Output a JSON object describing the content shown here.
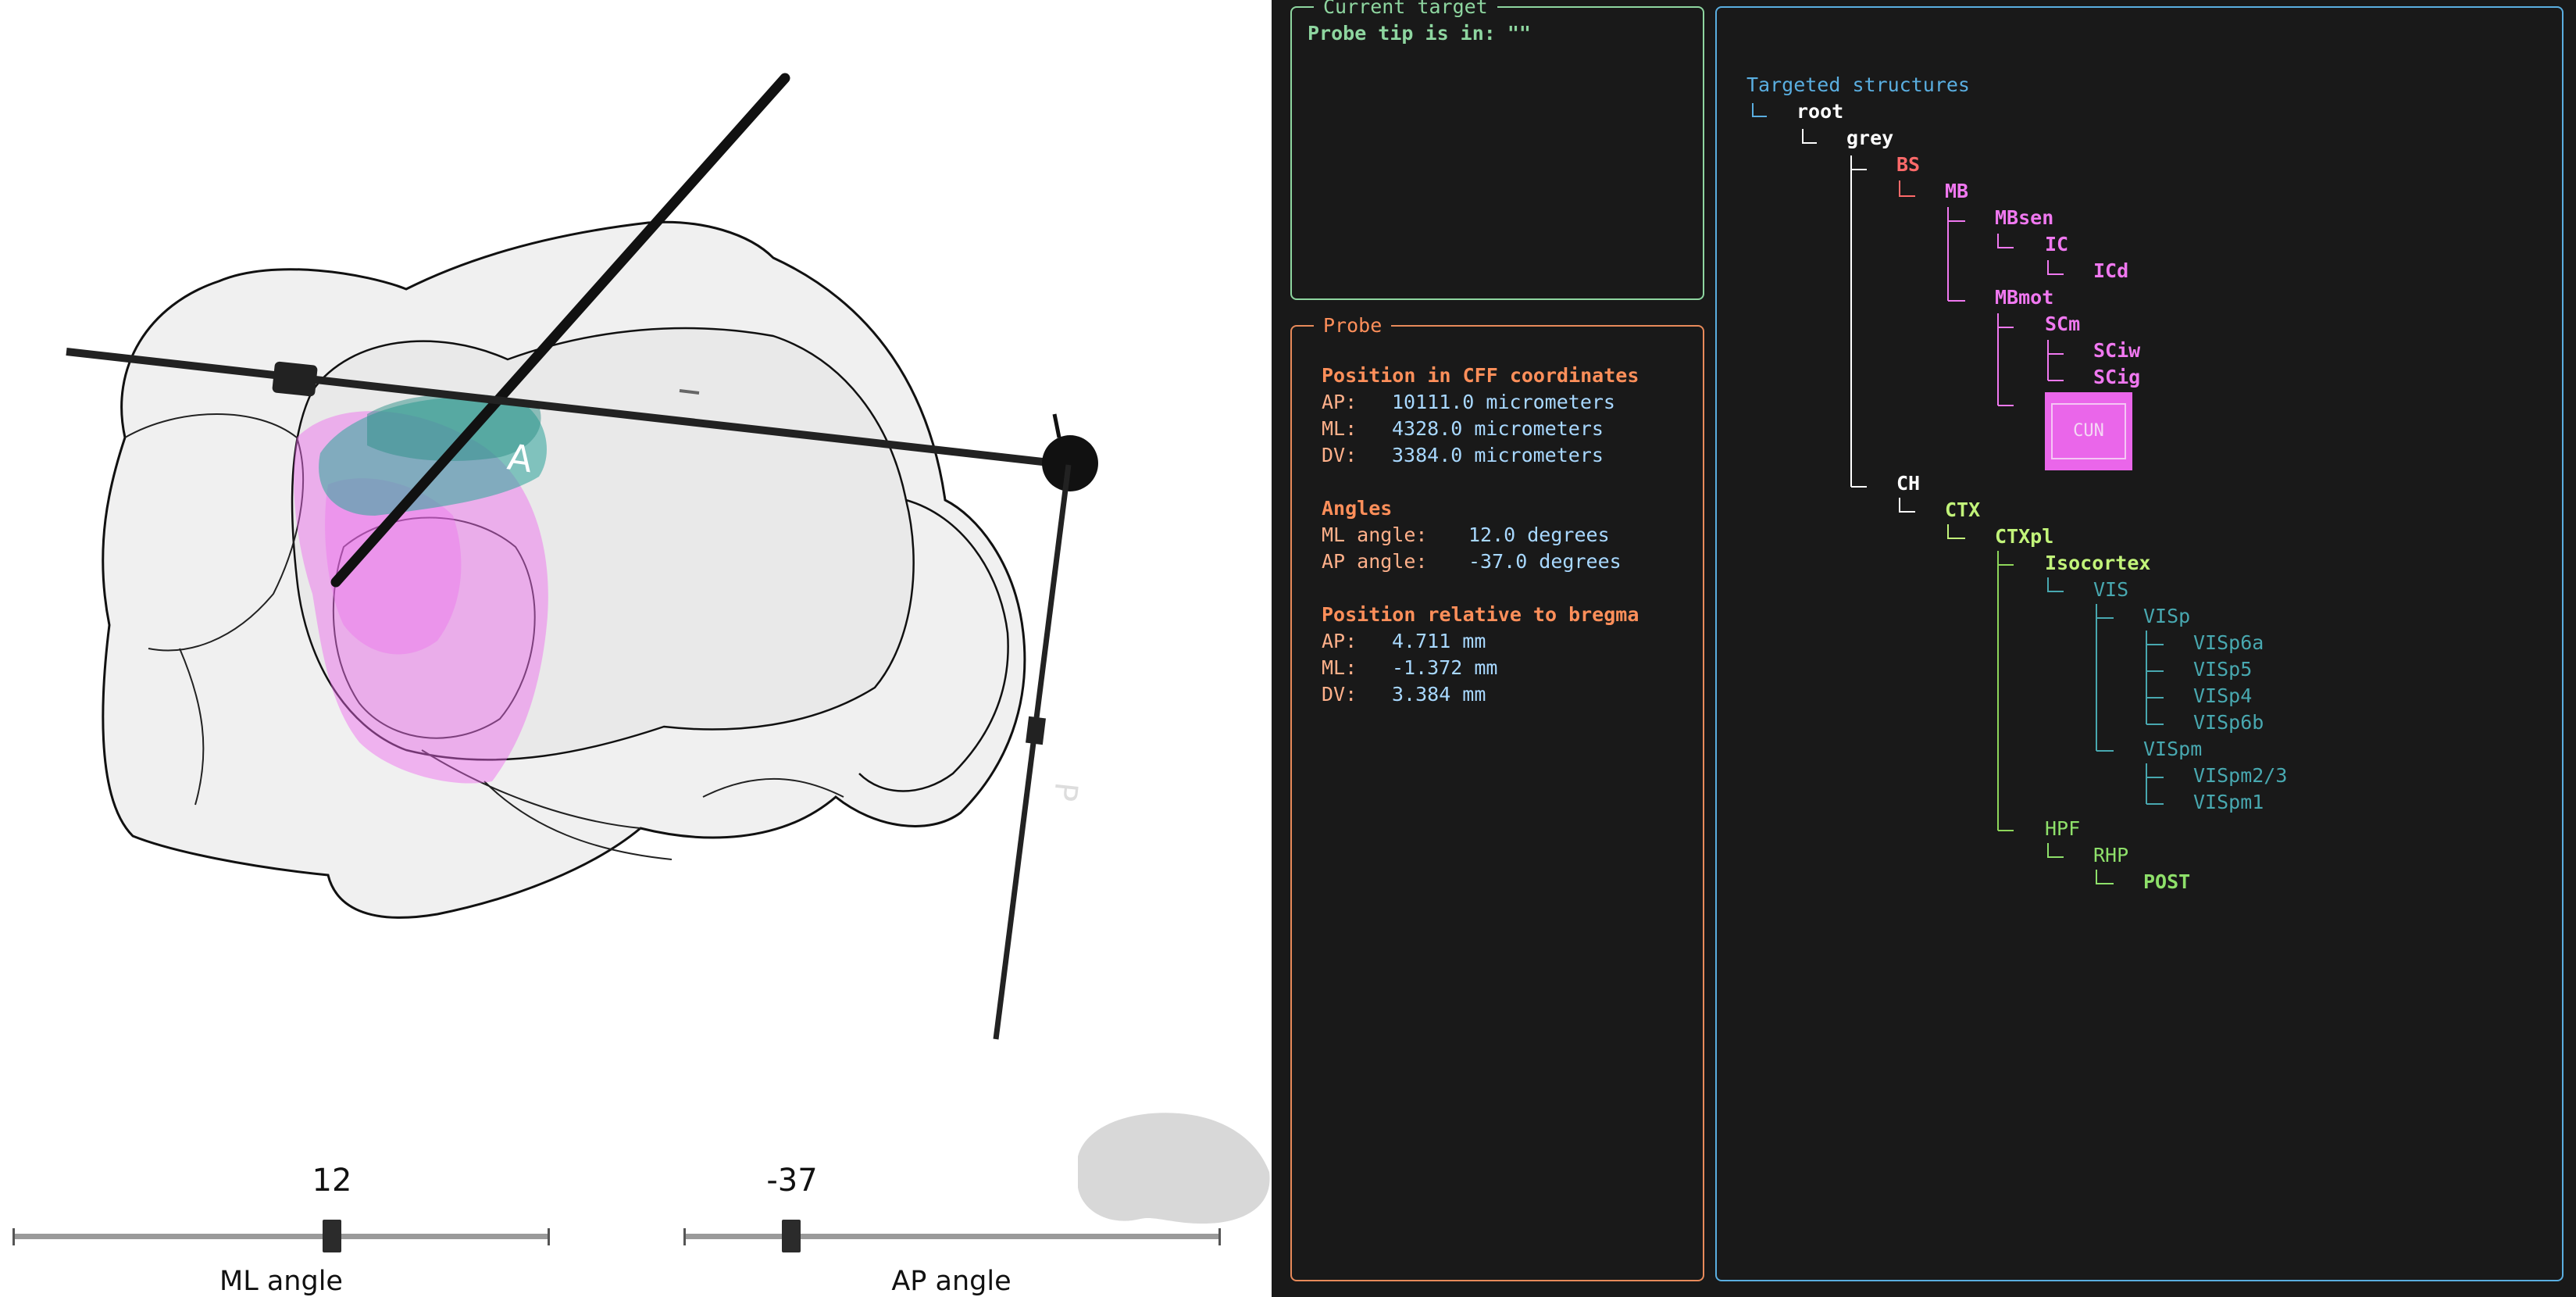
{
  "viewer": {
    "ml_slider": {
      "value": "12",
      "caption": "ML angle"
    },
    "ap_slider": {
      "value": "-37",
      "caption": "AP angle"
    },
    "labels": {
      "a": "A",
      "p": "P"
    }
  },
  "current_target": {
    "title": "Current target",
    "text": "Probe tip is in: \"\""
  },
  "probe": {
    "title": "Probe",
    "cff_heading": "Position in CFF coordinates",
    "cff": [
      {
        "label": "AP:",
        "value": "10111.0 micrometers"
      },
      {
        "label": "ML:",
        "value": "4328.0 micrometers"
      },
      {
        "label": "DV:",
        "value": "3384.0 micrometers"
      }
    ],
    "angles_heading": "Angles",
    "angles": [
      {
        "label": "ML angle:",
        "value": "12.0 degrees"
      },
      {
        "label": "AP angle:",
        "value": "-37.0 degrees"
      }
    ],
    "bregma_heading": "Position relative to bregma",
    "bregma": [
      {
        "label": "AP:",
        "value": "4.711 mm"
      },
      {
        "label": "ML:",
        "value": "-1.372 mm"
      },
      {
        "label": "DV:",
        "value": "3.384 mm"
      }
    ]
  },
  "structures": {
    "heading": "Targeted structures",
    "nodes": [
      {
        "name": "root",
        "color": "#ffffff"
      },
      {
        "name": "grey",
        "color": "#ffffff"
      },
      {
        "name": "BS",
        "color": "#ff6a6a"
      },
      {
        "name": "MB",
        "color": "#f078f0"
      },
      {
        "name": "MBsen",
        "color": "#f078f0"
      },
      {
        "name": "IC",
        "color": "#f078f0"
      },
      {
        "name": "ICd",
        "color": "#f078f0"
      },
      {
        "name": "MBmot",
        "color": "#f078f0"
      },
      {
        "name": "SCm",
        "color": "#f078f0"
      },
      {
        "name": "SCiw",
        "color": "#f078f0"
      },
      {
        "name": "SCig",
        "color": "#f078f0"
      },
      {
        "name": "CUN",
        "color": "#f5d8f5"
      },
      {
        "name": "CH",
        "color": "#ffffff"
      },
      {
        "name": "CTX",
        "color": "#c2f47a"
      },
      {
        "name": "CTXpl",
        "color": "#c2f47a"
      },
      {
        "name": "Isocortex",
        "color": "#c2f47a"
      },
      {
        "name": "VIS",
        "color": "#48a8b0"
      },
      {
        "name": "VISp",
        "color": "#48a8b0"
      },
      {
        "name": "VISp6a",
        "color": "#48a8b0"
      },
      {
        "name": "VISp5",
        "color": "#48a8b0"
      },
      {
        "name": "VISp4",
        "color": "#48a8b0"
      },
      {
        "name": "VISp6b",
        "color": "#48a8b0"
      },
      {
        "name": "VISpm",
        "color": "#48a8b0"
      },
      {
        "name": "VISpm2/3",
        "color": "#48a8b0"
      },
      {
        "name": "VISpm1",
        "color": "#48a8b0"
      },
      {
        "name": "HPF",
        "color": "#8ee06a"
      },
      {
        "name": "RHP",
        "color": "#8ee06a"
      },
      {
        "name": "POST",
        "color": "#8ee06a"
      }
    ]
  },
  "colors": {
    "panel_bg": "#191919",
    "current_target_border": "#8ed6a0",
    "probe_border": "#e88a5a",
    "structures_border": "#5aaee0",
    "probe_heading": "#ff8f5a",
    "probe_value": "#a8d8ff",
    "probe_label": "#ffb08a",
    "tree_heading": "#5aaee0"
  }
}
